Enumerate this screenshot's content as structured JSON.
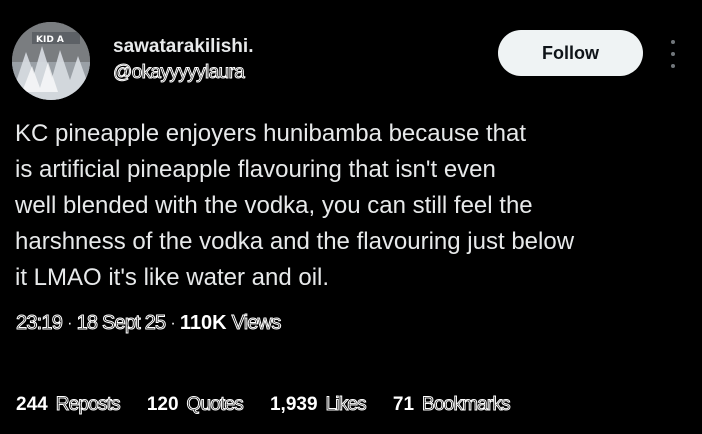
{
  "author": {
    "display_name": "sawatarakilishi.",
    "handle": "@okayyyyylaura",
    "avatar_label": "KID A"
  },
  "actions": {
    "follow_label": "Follow",
    "more_icon": "more-vertical-icon"
  },
  "tweet": {
    "lines": [
      "KC pineapple enjoyers hunibamba because that",
      "is artificial pineapple flavouring that isn't even",
      "well blended with the vodka, you can still feel the",
      "harshness of the vodka and the flavouring just below",
      "it LMAO it's like water and oil."
    ]
  },
  "meta": {
    "time": "23:19",
    "separator": "·",
    "date": "18 Sept 25",
    "views_count": "110K",
    "views_label": "Views"
  },
  "stats": {
    "reposts": {
      "count": "244",
      "label": "Reposts"
    },
    "quotes": {
      "count": "120",
      "label": "Quotes"
    },
    "likes": {
      "count": "1,939",
      "label": "Likes"
    },
    "bookmarks": {
      "count": "71",
      "label": "Bookmarks"
    }
  },
  "colors": {
    "background": "#000000",
    "text": "#e7e9ea",
    "follow_bg": "#eff3f4",
    "follow_text": "#0f1419",
    "muted": "#71767b"
  }
}
